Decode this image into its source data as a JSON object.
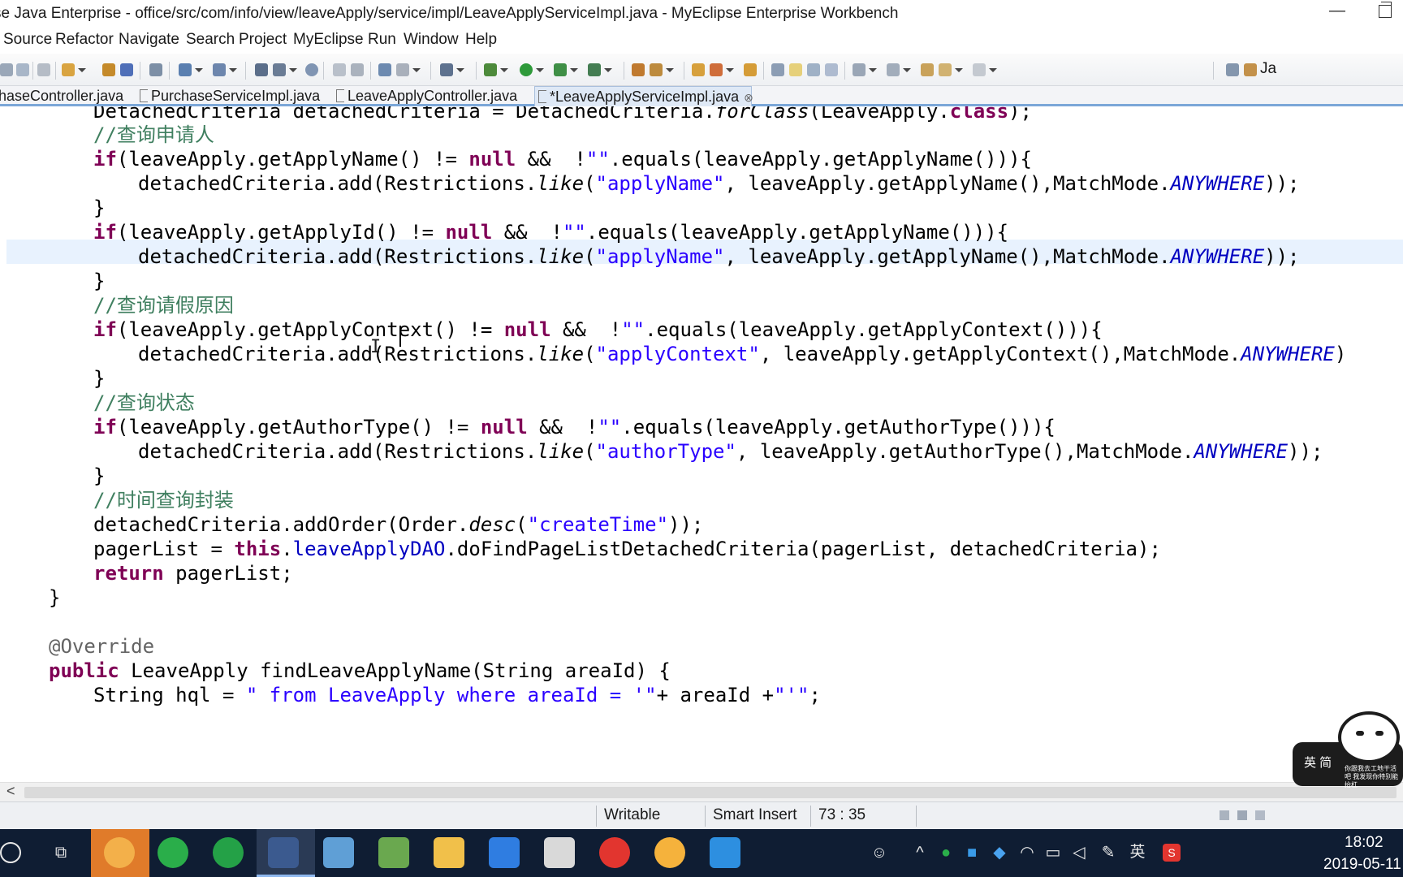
{
  "window": {
    "title": "se Java Enterprise - office/src/com/info/view/leaveApply/service/impl/LeaveApplyServiceImpl.java - MyEclipse Enterprise Workbench"
  },
  "menu": [
    "Source",
    "Refactor",
    "Navigate",
    "Search",
    "Project",
    "MyEclipse",
    "Run",
    "Window",
    "Help"
  ],
  "perspective_label": "Ja",
  "tabs": [
    {
      "label": "haseController.java",
      "active": false
    },
    {
      "label": "PurchaseServiceImpl.java",
      "active": false
    },
    {
      "label": "LeaveApplyController.java",
      "active": false
    },
    {
      "label": "*LeaveApplyServiceImpl.java",
      "active": true
    }
  ],
  "code": {
    "l1": "DetachedCriteria detachedCriteria = DetachedCriteria.forClass(LeaveApply.class);",
    "c1": "//查询申请人",
    "c2": "//查询请假原因",
    "c3": "//查询状态",
    "c4": "//时间查询封装",
    "annotation": "@Override"
  },
  "status": {
    "mode": "Writable",
    "insert": "Smart Insert",
    "position": "73 : 35"
  },
  "sticker": {
    "label": "英 简",
    "caption": "你跟我去工地干活吧 我发现你特别能抬杠"
  },
  "taskbar": {
    "time": "18:02",
    "date": "2019-05-11",
    "ime": "英"
  },
  "colors": {
    "keyword": "#7f0055",
    "string": "#2a00ff",
    "comment": "#3f7f5f",
    "field": "#0000c0",
    "current_line": "#e8f2fe",
    "taskbar": "#0f1d33"
  }
}
